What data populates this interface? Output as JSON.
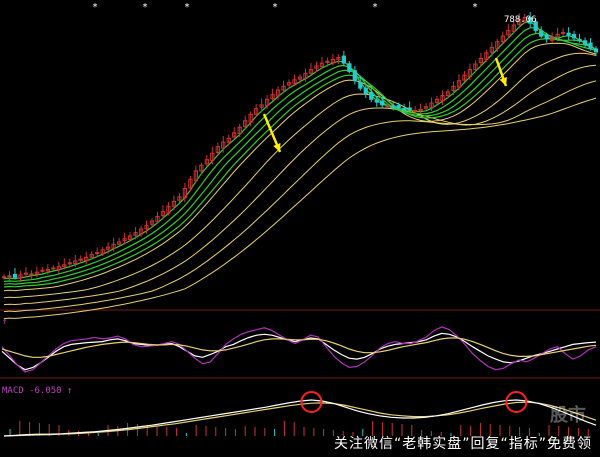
{
  "colors": {
    "background": "#000000",
    "up": "#cc3333",
    "down": "#22cccc",
    "ma_short": "#33cc33",
    "ma_long": "#e8d070",
    "indicator_a": "#ffffff",
    "indicator_b": "#b030c0",
    "indicator_c": "#e8d070",
    "macd_bar": "#cc3333",
    "arrow": "#ffee00",
    "circle": "#ff2020",
    "label": "#c040c0"
  },
  "icons": {
    "arrow": "yellow-down-arrow",
    "circle": "red-circle-marker"
  },
  "main_panel": {
    "top_marker": "*",
    "high_label": "788.06"
  },
  "panel2": {
    "label": "↑"
  },
  "macd_panel": {
    "label": "MACD -6.050 ↑"
  },
  "watermark": {
    "caption": "关注微信“老韩实盘”回复“指标”免费领",
    "logo": "股市"
  },
  "chart_data": [
    {
      "type": "candlestick",
      "high_label": 788.06,
      "note": "index levels (relative); up = red hollow, down = cyan filled",
      "close": [
        230,
        232,
        229,
        234,
        238,
        236,
        240,
        244,
        246,
        249,
        252,
        256,
        260,
        264,
        268,
        272,
        278,
        282,
        288,
        294,
        300,
        305,
        312,
        318,
        325,
        333,
        340,
        350,
        360,
        370,
        382,
        392,
        402,
        420,
        440,
        458,
        470,
        482,
        496,
        510,
        520,
        528,
        540,
        552,
        566,
        580,
        592,
        600,
        612,
        622,
        632,
        640,
        648,
        654,
        660,
        668,
        676,
        684,
        690,
        694,
        698,
        702,
        690,
        672,
        652,
        636,
        624,
        612,
        606,
        600,
        598,
        596,
        594,
        592,
        590,
        588,
        590,
        596,
        604,
        612,
        620,
        628,
        640,
        652,
        664,
        676,
        688,
        700,
        712,
        724,
        736,
        748,
        760,
        772,
        784,
        788,
        776,
        760,
        748,
        742,
        746,
        752,
        756,
        750,
        744,
        738,
        730,
        722,
        714
      ],
      "ma_bundle_short": [
        "MA5",
        "MA10",
        "MA20",
        "MA30"
      ],
      "ma_bundle_long": [
        "MA40",
        "MA60",
        "MA90",
        "MA120",
        "MA150"
      ]
    },
    {
      "type": "line",
      "series": [
        {
          "key": "a",
          "values": [
            0.45,
            0.3,
            0.15,
            0.05,
            0.1,
            0.2,
            0.32,
            0.45,
            0.55,
            0.6,
            0.62,
            0.64,
            0.65,
            0.66,
            0.7,
            0.72,
            0.68,
            0.62,
            0.6,
            0.58,
            0.58,
            0.6,
            0.62,
            0.55,
            0.45,
            0.35,
            0.32,
            0.38,
            0.45,
            0.55,
            0.6,
            0.68,
            0.75,
            0.8,
            0.82,
            0.8,
            0.75,
            0.7,
            0.66,
            0.7,
            0.74,
            0.72,
            0.6,
            0.48,
            0.38,
            0.3,
            0.28,
            0.32,
            0.4,
            0.5,
            0.56,
            0.6,
            0.62,
            0.64,
            0.66,
            0.7,
            0.78,
            0.84,
            0.82,
            0.76,
            0.66,
            0.55,
            0.45,
            0.35,
            0.28,
            0.22,
            0.2,
            0.24,
            0.3,
            0.36,
            0.4,
            0.45,
            0.5,
            0.55,
            0.6,
            0.62,
            0.64,
            0.65
          ]
        },
        {
          "key": "b",
          "values": [
            0.55,
            0.35,
            0.15,
            0.0,
            0.05,
            0.2,
            0.35,
            0.5,
            0.62,
            0.68,
            0.7,
            0.72,
            0.75,
            0.72,
            0.74,
            0.78,
            0.72,
            0.6,
            0.55,
            0.56,
            0.58,
            0.62,
            0.66,
            0.6,
            0.45,
            0.3,
            0.18,
            0.22,
            0.4,
            0.6,
            0.72,
            0.82,
            0.88,
            0.92,
            0.96,
            0.9,
            0.8,
            0.7,
            0.62,
            0.7,
            0.8,
            0.76,
            0.55,
            0.35,
            0.2,
            0.1,
            0.12,
            0.22,
            0.36,
            0.52,
            0.62,
            0.66,
            0.62,
            0.62,
            0.68,
            0.76,
            0.9,
            0.98,
            0.92,
            0.78,
            0.6,
            0.4,
            0.25,
            0.12,
            0.05,
            0.08,
            0.18,
            0.26,
            0.22,
            0.3,
            0.4,
            0.5,
            0.55,
            0.4,
            0.28,
            0.35,
            0.48,
            0.55
          ]
        },
        {
          "key": "c",
          "values": [
            0.5,
            0.45,
            0.4,
            0.35,
            0.32,
            0.32,
            0.34,
            0.38,
            0.42,
            0.46,
            0.5,
            0.54,
            0.57,
            0.6,
            0.62,
            0.64,
            0.65,
            0.64,
            0.62,
            0.6,
            0.59,
            0.59,
            0.6,
            0.59,
            0.56,
            0.52,
            0.48,
            0.46,
            0.46,
            0.48,
            0.52,
            0.56,
            0.61,
            0.66,
            0.7,
            0.72,
            0.72,
            0.71,
            0.7,
            0.7,
            0.71,
            0.71,
            0.68,
            0.63,
            0.57,
            0.5,
            0.45,
            0.42,
            0.42,
            0.44,
            0.47,
            0.51,
            0.55,
            0.58,
            0.61,
            0.64,
            0.68,
            0.72,
            0.74,
            0.74,
            0.71,
            0.66,
            0.6,
            0.53,
            0.46,
            0.4,
            0.36,
            0.34,
            0.34,
            0.35,
            0.38,
            0.41,
            0.44,
            0.47,
            0.5,
            0.53,
            0.56,
            0.58
          ]
        }
      ]
    },
    {
      "type": "macd",
      "label": "MACD -6.050",
      "dif": [
        0.0,
        0.02,
        0.04,
        0.05,
        0.05,
        0.06,
        0.08,
        0.1,
        0.12,
        0.15,
        0.18,
        0.22,
        0.26,
        0.3,
        0.35,
        0.4,
        0.45,
        0.5,
        0.55,
        0.6,
        0.65,
        0.7,
        0.75,
        0.8,
        0.86,
        0.92,
        0.97,
        1.0,
        0.97,
        0.9,
        0.8,
        0.7,
        0.62,
        0.56,
        0.52,
        0.5,
        0.5,
        0.52,
        0.56,
        0.62,
        0.7,
        0.78,
        0.86,
        0.93,
        0.98,
        1.0,
        0.97,
        0.9,
        0.8,
        0.68,
        0.55,
        0.42,
        0.3
      ],
      "dea": [
        0.0,
        0.01,
        0.02,
        0.03,
        0.04,
        0.05,
        0.06,
        0.08,
        0.1,
        0.12,
        0.15,
        0.18,
        0.22,
        0.26,
        0.3,
        0.34,
        0.39,
        0.44,
        0.49,
        0.54,
        0.59,
        0.64,
        0.69,
        0.74,
        0.79,
        0.84,
        0.88,
        0.91,
        0.92,
        0.9,
        0.85,
        0.78,
        0.71,
        0.64,
        0.59,
        0.56,
        0.54,
        0.54,
        0.56,
        0.59,
        0.64,
        0.7,
        0.77,
        0.83,
        0.89,
        0.93,
        0.94,
        0.91,
        0.85,
        0.76,
        0.66,
        0.55,
        0.44
      ],
      "circles_at_index": [
        27,
        45
      ]
    }
  ]
}
